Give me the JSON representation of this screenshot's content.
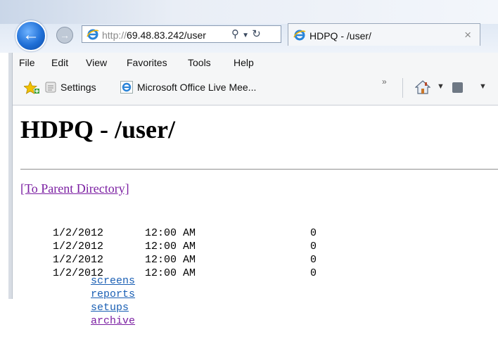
{
  "browser": {
    "address_url_prefix": "http://",
    "address_url_host": "69.48.83.242/user",
    "tab_title": "HDPQ - /user/",
    "tab_close": "×",
    "menu": [
      "File",
      "Edit",
      "View",
      "Favorites",
      "Tools",
      "Help"
    ],
    "favorites": {
      "settings_label": "Settings",
      "live_meeting_label": "Microsoft Office Live Mee...",
      "overflow": "»"
    }
  },
  "page": {
    "title": "HDPQ - /user/",
    "parent_link": "[To Parent Directory]",
    "entries": [
      {
        "date": "1/2/2012",
        "time": "12:00 AM",
        "size": "0",
        "name": "screens",
        "visited": false
      },
      {
        "date": "1/2/2012",
        "time": "12:00 AM",
        "size": "0",
        "name": "reports",
        "visited": false
      },
      {
        "date": "1/2/2012",
        "time": "12:00 AM",
        "size": "0",
        "name": "setups",
        "visited": false
      },
      {
        "date": "1/2/2012",
        "time": "12:00 AM",
        "size": "0",
        "name": "archive",
        "visited": true
      }
    ]
  },
  "colors": {
    "link": "#1a5fb4",
    "visited_link": "#7b1fa2"
  }
}
